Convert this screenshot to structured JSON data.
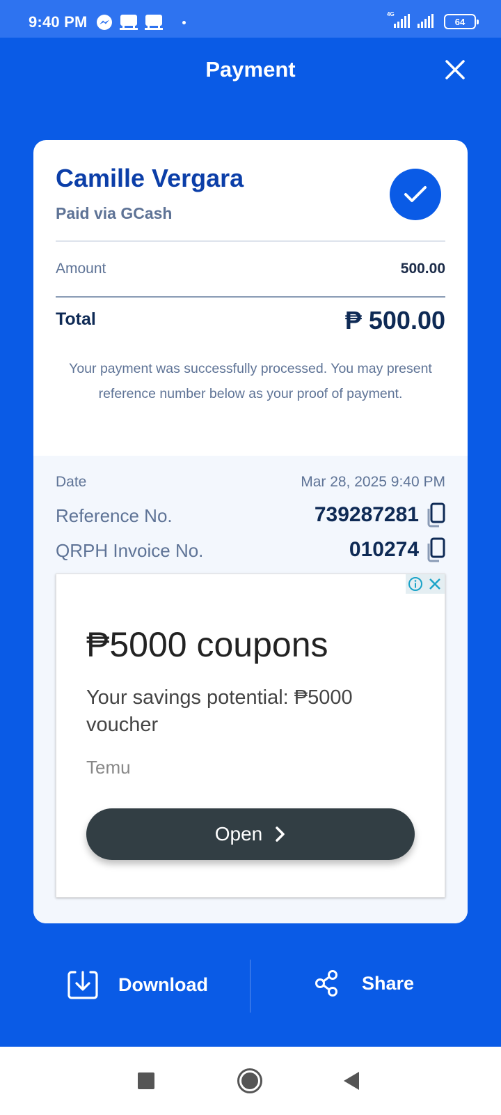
{
  "status_bar": {
    "time": "9:40 PM",
    "network_label": "4G",
    "battery": "64"
  },
  "header": {
    "title": "Payment"
  },
  "receipt": {
    "payee_name": "Camille Vergara",
    "payment_method": "Paid via GCash",
    "amount_label": "Amount",
    "amount_value": "500.00",
    "total_label": "Total",
    "total_value": "₱ 500.00",
    "note": "Your payment was successfully processed. You may present reference number below as your proof of payment."
  },
  "details": {
    "date_label": "Date",
    "date_value": "Mar 28, 2025 9:40 PM",
    "reference_label": "Reference No.",
    "reference_value": "739287281",
    "invoice_label": "QRPH Invoice No.",
    "invoice_value": "010274"
  },
  "ad": {
    "title": "₱5000 coupons",
    "description": "Your savings potential: ₱5000 voucher",
    "brand": "Temu",
    "button_label": "Open"
  },
  "actions": {
    "download_label": "Download",
    "share_label": "Share"
  },
  "colors": {
    "primary_blue": "#0A5BE6",
    "status_bar_blue": "#2E73F0",
    "navy": "#0E2A55",
    "muted": "#5E7396",
    "ad_button": "#323E44"
  },
  "icons": [
    "messenger-icon",
    "notification-icon",
    "check-icon",
    "close-icon",
    "copy-icon",
    "info-icon",
    "download-icon",
    "share-icon"
  ]
}
